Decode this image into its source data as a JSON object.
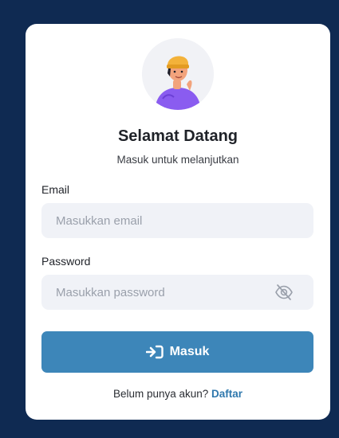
{
  "login": {
    "title": "Selamat Datang",
    "subtitle": "Masuk untuk melanjutkan",
    "email_label": "Email",
    "email_placeholder": "Masukkan email",
    "email_value": "",
    "password_label": "Password",
    "password_placeholder": "Masukkan password",
    "password_value": "",
    "submit_label": "Masuk",
    "footer_text": "Belum punya akun?",
    "register_link": "Daftar"
  },
  "icons": {
    "avatar": "user-avatar-illustration",
    "password_toggle": "eye-slash-icon",
    "submit": "sign-in-icon"
  },
  "colors": {
    "background": "#0f2a52",
    "card": "#ffffff",
    "input_bg": "#f0f2f7",
    "button": "#3d86b9",
    "link": "#2f78ad"
  }
}
